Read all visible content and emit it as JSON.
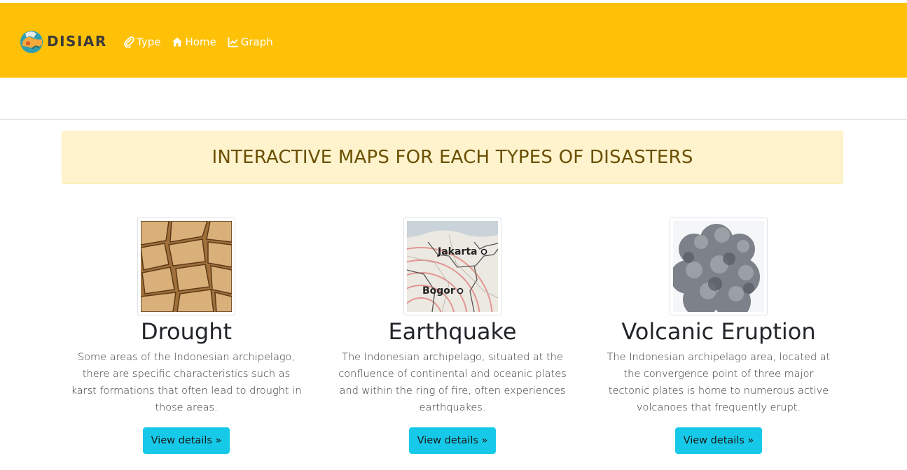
{
  "brand": {
    "name": "DISIAR"
  },
  "nav": [
    {
      "label": "Type",
      "icon": "paperclip-icon"
    },
    {
      "label": "Home",
      "icon": "home-icon"
    },
    {
      "label": "Graph",
      "icon": "line-chart-icon"
    }
  ],
  "banner": {
    "title": "INTERACTIVE MAPS FOR EACH TYPES OF DISASTERS"
  },
  "cards": [
    {
      "title": "Drought",
      "description": "Some areas of the Indonesian archipelago, there are specific characteristics such as karst formations that often lead to drought in those areas.",
      "button": "View details »"
    },
    {
      "title": "Earthquake",
      "description": "The Indonesian archipelago, situated at the confluence of continental and oceanic plates and within the ring of fire, often experiences earthquakes.",
      "button": "View details »",
      "map_labels": [
        "Jakarta",
        "Bogor"
      ]
    },
    {
      "title": "Volcanic Eruption",
      "description": "The Indonesian archipelago area, located at the convergence point of three major tectonic plates is home to numerous active volcanoes that frequently erupt.",
      "button": "View details »"
    }
  ],
  "colors": {
    "navbar": "#ffc107",
    "banner_bg": "#fff3cd",
    "banner_text": "#6a5000",
    "button": "#17c9e8"
  }
}
